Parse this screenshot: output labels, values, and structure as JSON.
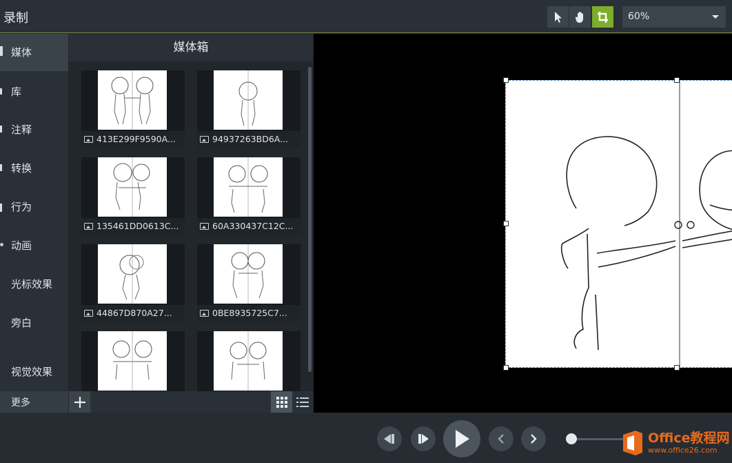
{
  "header": {
    "title": "录制",
    "zoom_value": "60%"
  },
  "tools": {
    "pointer_icon": "pointer-arrow",
    "hand_icon": "pan-hand",
    "crop_icon": "crop",
    "active": "crop",
    "active_color": "#7cad2d"
  },
  "sidebar": {
    "items": [
      {
        "label": "媒体"
      },
      {
        "label": "库"
      },
      {
        "label": "注释"
      },
      {
        "label": "转换"
      },
      {
        "label": "行为"
      },
      {
        "label": "动画"
      },
      {
        "label": "光标效果"
      },
      {
        "label": "旁白"
      },
      {
        "label": "视觉效果"
      }
    ],
    "more_label": "更多"
  },
  "media_bin": {
    "title": "媒体箱",
    "items": [
      {
        "name": "413E299F9590A..."
      },
      {
        "name": "94937263BD6A..."
      },
      {
        "name": "135461DD0613C..."
      },
      {
        "name": "60A330437C12C..."
      },
      {
        "name": "44867D870A27..."
      },
      {
        "name": "0BE8935725C7..."
      },
      {
        "name": ""
      },
      {
        "name": ""
      }
    ],
    "view_mode": "grid"
  },
  "playback": {
    "buttons": [
      "step-back",
      "step-forward",
      "play",
      "previous",
      "next"
    ]
  },
  "watermark": {
    "title": "Office教程网",
    "url": "www.office26.com",
    "color": "#e86a1c"
  }
}
